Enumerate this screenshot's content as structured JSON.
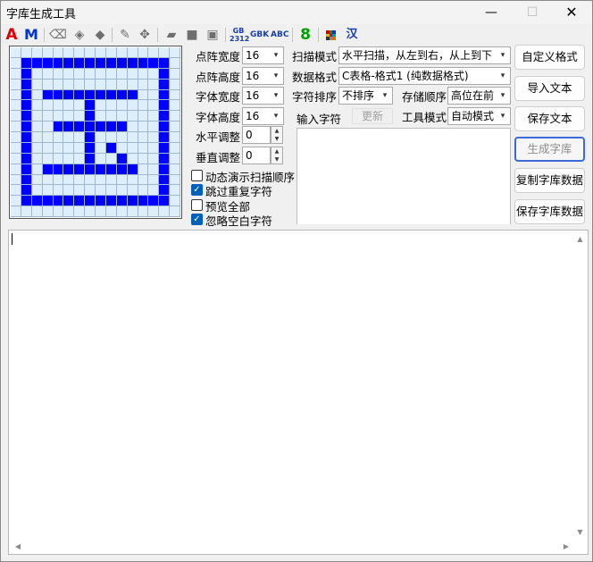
{
  "window": {
    "title": "字库生成工具",
    "minimize": "—",
    "maximize": "☐",
    "close": "✕"
  },
  "toolbar": {
    "icons": [
      {
        "name": "bold-red-a-icon",
        "glyph": "A"
      },
      {
        "name": "bold-blue-m-icon",
        "glyph": "M"
      },
      {
        "name": "eraser-icon",
        "glyph": "⌫"
      },
      {
        "name": "fill-bucket-icon",
        "glyph": "◈"
      },
      {
        "name": "stamp-icon",
        "glyph": "◆"
      },
      {
        "name": "pencil-icon",
        "glyph": "✎"
      },
      {
        "name": "move-icon",
        "glyph": "✥"
      },
      {
        "name": "open-folder-icon",
        "glyph": "▰"
      },
      {
        "name": "save-icon",
        "glyph": "■"
      },
      {
        "name": "save-as-icon",
        "glyph": "▣"
      }
    ],
    "gb2312_line1": "GB",
    "gb2312_line2": "2312",
    "gbk": "GBK",
    "abc": "ABC",
    "digit": "8",
    "han": "汉"
  },
  "pixel_grid": {
    "rows": 16,
    "cols": 16,
    "on_color": "#0000ff",
    "off_color": "#dfeefb",
    "bitmap": [
      "0000000000000000",
      "0111111111111110",
      "0100000000000010",
      "0100000000000010",
      "0101111111110010",
      "0100000100000010",
      "0100000100000010",
      "0100111111100010",
      "0100000100000010",
      "0100000101000010",
      "0100000100100010",
      "0101111111110010",
      "0100000000000010",
      "0100000000000010",
      "0111111111111110",
      "0000000000000000"
    ]
  },
  "settings": {
    "dot_width": {
      "label": "点阵宽度",
      "value": "16"
    },
    "dot_height": {
      "label": "点阵高度",
      "value": "16"
    },
    "font_width": {
      "label": "字体宽度",
      "value": "16"
    },
    "font_height": {
      "label": "字体高度",
      "value": "16"
    },
    "h_adjust": {
      "label": "水平调整",
      "value": "0"
    },
    "v_adjust": {
      "label": "垂直调整",
      "value": "0"
    }
  },
  "checkboxes": [
    {
      "label": "动态演示扫描顺序",
      "checked": false
    },
    {
      "label": "跳过重复字符",
      "checked": true
    },
    {
      "label": "预览全部",
      "checked": false
    },
    {
      "label": "忽略空白字符",
      "checked": true
    }
  ],
  "modes": {
    "scan_mode": {
      "label": "扫描模式",
      "value": "水平扫描，从左到右，从上到下"
    },
    "data_format": {
      "label": "数据格式",
      "value": "C表格-格式1 (纯数据格式)"
    },
    "char_sort": {
      "label": "字符排序",
      "value": "不排序"
    },
    "store_order": {
      "label": "存储顺序",
      "value": "高位在前"
    },
    "tool_mode": {
      "label": "工具模式",
      "value": "自动模式"
    },
    "input_chars_label": "输入字符",
    "refresh": "更新"
  },
  "buttons": {
    "custom_format": "自定义格式",
    "import_text": "导入文本",
    "save_text": "保存文本",
    "generate_font": "生成字库",
    "copy_font_data": "复制字库数据",
    "save_font_data": "保存字库数据"
  },
  "scroll": {
    "up": "▲",
    "down": "▼",
    "left": "◀",
    "right": "▶"
  }
}
